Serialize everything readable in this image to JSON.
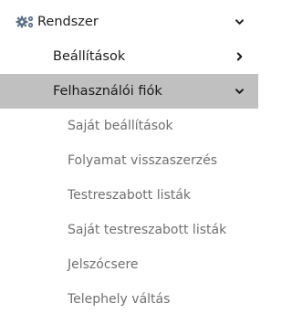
{
  "colors": {
    "active_background": "#c0c0c0",
    "icon_color": "#5a6f86",
    "subitem_text": "#707070"
  },
  "menu": {
    "root": {
      "label": "Rendszer",
      "icon": "gear-icon",
      "expanded": true
    },
    "items": [
      {
        "label": "Beállítások",
        "expanded": false,
        "active": false
      },
      {
        "label": "Felhasználói fiók",
        "expanded": true,
        "active": true
      }
    ],
    "subitems": [
      {
        "label": "Saját beállítások"
      },
      {
        "label": "Folyamat visszaszerzés"
      },
      {
        "label": "Testreszabott listák"
      },
      {
        "label": "Saját testreszabott listák"
      },
      {
        "label": "Jelszócsere"
      },
      {
        "label": "Telephely váltás"
      }
    ]
  }
}
